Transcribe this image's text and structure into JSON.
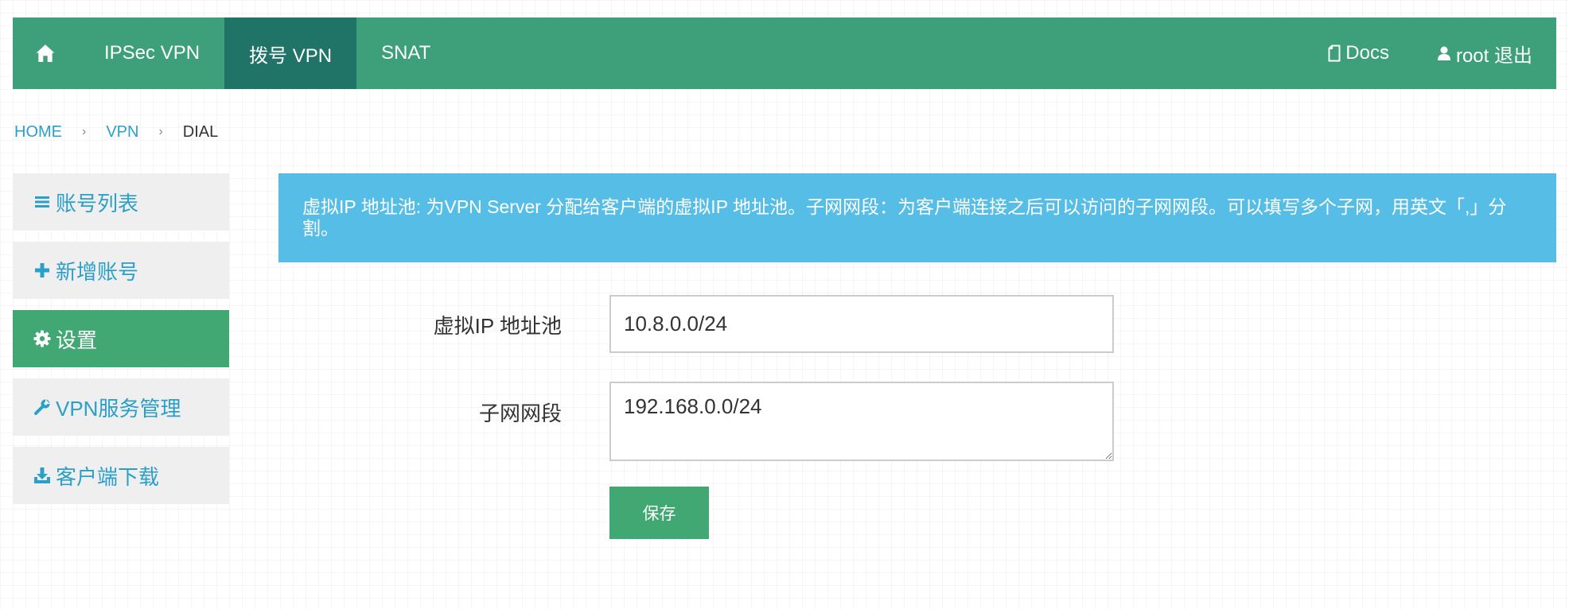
{
  "colors": {
    "navbar_bg": "#3e9f7b",
    "navbar_active_bg": "#1f7467",
    "sidebar_active_bg": "#41a874",
    "link": "#2a9fc9",
    "alert_bg": "#56bde6",
    "button_bg": "#41a874"
  },
  "navbar": {
    "home_icon": "home-icon",
    "items": [
      {
        "label": "IPSec VPN",
        "active": false
      },
      {
        "label": "拨号 VPN",
        "active": true
      },
      {
        "label": "SNAT",
        "active": false
      }
    ],
    "right": {
      "docs_icon": "document-icon",
      "docs_label": "Docs",
      "user_icon": "user-icon",
      "user_label": "root 退出"
    }
  },
  "breadcrumb": {
    "items": [
      "HOME",
      "VPN"
    ],
    "current": "DIAL",
    "separator": "›"
  },
  "sidebar": {
    "items": [
      {
        "icon": "list-icon",
        "label": "账号列表",
        "active": false
      },
      {
        "icon": "plus-icon",
        "label": "新增账号",
        "active": false
      },
      {
        "icon": "gear-icon",
        "label": "设置",
        "active": true
      },
      {
        "icon": "wrench-icon",
        "label": "VPN服务管理",
        "active": false
      },
      {
        "icon": "download-icon",
        "label": "客户端下载",
        "active": false
      }
    ]
  },
  "alert": {
    "text": "虚拟IP 地址池: 为VPN Server 分配给客户端的虚拟IP 地址池。子网网段：为客户端连接之后可以访问的子网网段。可以填写多个子网，用英文「,」分割。"
  },
  "form": {
    "pool_label": "虚拟IP 地址池",
    "pool_value": "10.8.0.0/24",
    "subnet_label": "子网网段",
    "subnet_value": "192.168.0.0/24",
    "save_label": "保存"
  }
}
